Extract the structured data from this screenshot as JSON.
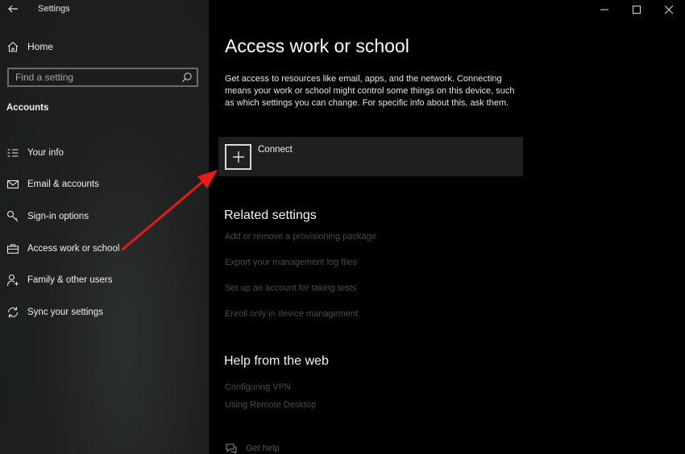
{
  "window": {
    "title": "Settings",
    "controls": [
      "minimize-icon",
      "maximize-icon",
      "close-icon"
    ]
  },
  "sidebar": {
    "home_label": "Home",
    "search_placeholder": "Find a setting",
    "section_title": "Accounts",
    "items": [
      {
        "label": "Your info",
        "icon": "person-card-icon"
      },
      {
        "label": "Email & accounts",
        "icon": "mail-icon"
      },
      {
        "label": "Sign-in options",
        "icon": "key-icon"
      },
      {
        "label": "Access work or school",
        "icon": "briefcase-icon"
      },
      {
        "label": "Family & other users",
        "icon": "person-add-icon"
      },
      {
        "label": "Sync your settings",
        "icon": "sync-icon"
      }
    ]
  },
  "main": {
    "title": "Access work or school",
    "description": "Get access to resources like email, apps, and the network. Connecting means your work or school might control some things on this device, such as which settings you can change. For specific info about this, ask them.",
    "connect_label": "Connect",
    "related": {
      "heading": "Related settings",
      "links": [
        "Add or remove a provisioning package",
        "Export your management log files",
        "Set up an account for taking tests",
        "Enroll only in device management"
      ]
    },
    "help": {
      "heading": "Help from the web",
      "links": [
        "Configuring VPN",
        "Using Remote Desktop"
      ]
    },
    "get_help_label": "Get help"
  },
  "colors": {
    "sidebar_bg": "#1f2120",
    "main_bg": "#000000",
    "connect_row_bg": "#1f1f1f",
    "annotation_arrow": "#e81919"
  }
}
